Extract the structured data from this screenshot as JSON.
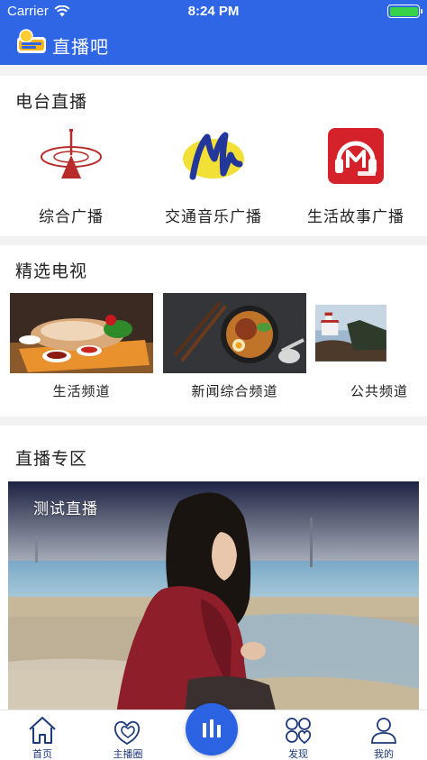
{
  "status_bar": {
    "carrier": "Carrier",
    "time": "8:24 PM"
  },
  "nav": {
    "title": "直播吧",
    "logo_icon": "app-logo-icon"
  },
  "radio": {
    "title": "电台直播",
    "items": [
      {
        "label": "综合广播",
        "icon": "broadcast-tower-icon"
      },
      {
        "label": "交通音乐广播",
        "icon": "traffic-music-logo-icon"
      },
      {
        "label": "生活故事广播",
        "icon": "headphones-logo-icon"
      }
    ]
  },
  "tv": {
    "title": "精选电视",
    "items": [
      {
        "label": "生活频道"
      },
      {
        "label": "新闻综合频道"
      },
      {
        "label": "公共频道"
      }
    ]
  },
  "live": {
    "title": "直播专区",
    "banner_caption": "测试直播"
  },
  "tab_bar": {
    "items": [
      {
        "label": "首页",
        "icon": "home-icon"
      },
      {
        "label": "主播圈",
        "icon": "hearts-icon"
      },
      {
        "label": "",
        "icon": "audio-bars-icon"
      },
      {
        "label": "发现",
        "icon": "discover-circles-icon"
      },
      {
        "label": "我的",
        "icon": "profile-icon"
      }
    ]
  },
  "colors": {
    "primary": "#2f66e6",
    "battery": "#37d24a",
    "tab_text": "#1d3a7a"
  }
}
